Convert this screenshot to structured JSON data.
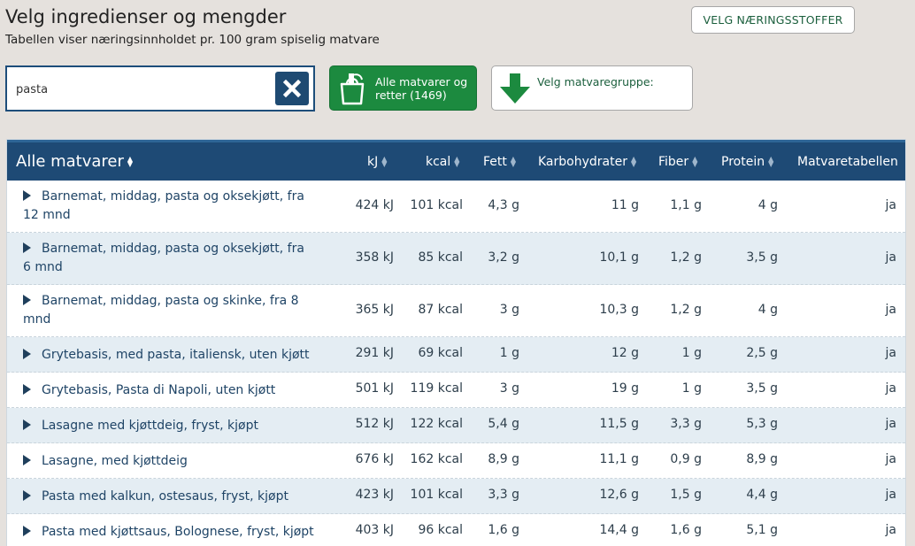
{
  "header": {
    "title": "Velg ingredienser og mengder",
    "subtitle": "Tabellen viser næringsinnholdet pr. 100 gram spiselig matvare",
    "nutrients_button": "VELG NÆRINGSSTOFFER"
  },
  "search": {
    "value": "pasta"
  },
  "filters": {
    "all_label": "Alle matvarer og retter (1469)",
    "group_label": "Velg matvaregruppe:"
  },
  "table": {
    "title": "Alle matvarer",
    "columns": [
      "kJ",
      "kcal",
      "Fett",
      "Karbohydrater",
      "Fiber",
      "Protein",
      "Matvaretabellen"
    ],
    "rows": [
      {
        "name": "Barnemat, middag, pasta og oksekjøtt, fra 12 mnd",
        "kj": "424 kJ",
        "kcal": "101 kcal",
        "fett": "4,3 g",
        "karbo": "11 g",
        "fiber": "1,1 g",
        "protein": "4 g",
        "mvt": "ja"
      },
      {
        "name": "Barnemat, middag, pasta og oksekjøtt, fra 6 mnd",
        "kj": "358 kJ",
        "kcal": "85 kcal",
        "fett": "3,2 g",
        "karbo": "10,1 g",
        "fiber": "1,2 g",
        "protein": "3,5 g",
        "mvt": "ja"
      },
      {
        "name": "Barnemat, middag, pasta og skinke, fra 8 mnd",
        "kj": "365 kJ",
        "kcal": "87 kcal",
        "fett": "3 g",
        "karbo": "10,3 g",
        "fiber": "1,2 g",
        "protein": "4 g",
        "mvt": "ja"
      },
      {
        "name": "Grytebasis, med pasta, italiensk, uten kjøtt",
        "kj": "291 kJ",
        "kcal": "69 kcal",
        "fett": "1 g",
        "karbo": "12 g",
        "fiber": "1 g",
        "protein": "2,5 g",
        "mvt": "ja"
      },
      {
        "name": "Grytebasis, Pasta di Napoli, uten kjøtt",
        "kj": "501 kJ",
        "kcal": "119 kcal",
        "fett": "3 g",
        "karbo": "19 g",
        "fiber": "1 g",
        "protein": "3,5 g",
        "mvt": "ja"
      },
      {
        "name": "Lasagne med kjøttdeig, fryst, kjøpt",
        "kj": "512 kJ",
        "kcal": "122 kcal",
        "fett": "5,4 g",
        "karbo": "11,5 g",
        "fiber": "3,3 g",
        "protein": "5,3 g",
        "mvt": "ja"
      },
      {
        "name": "Lasagne, med kjøttdeig",
        "kj": "676 kJ",
        "kcal": "162 kcal",
        "fett": "8,9 g",
        "karbo": "11,1 g",
        "fiber": "0,9 g",
        "protein": "8,9 g",
        "mvt": "ja"
      },
      {
        "name": "Pasta med kalkun, ostesaus, fryst, kjøpt",
        "kj": "423 kJ",
        "kcal": "101 kcal",
        "fett": "3,3 g",
        "karbo": "12,6 g",
        "fiber": "1,5 g",
        "protein": "4,4 g",
        "mvt": "ja"
      },
      {
        "name": "Pasta med kjøttsaus, Bolognese, fryst, kjøpt",
        "kj": "403 kJ",
        "kcal": "96 kcal",
        "fett": "1,6 g",
        "karbo": "14,4 g",
        "fiber": "1,6 g",
        "protein": "5,1 g",
        "mvt": "ja"
      }
    ]
  }
}
